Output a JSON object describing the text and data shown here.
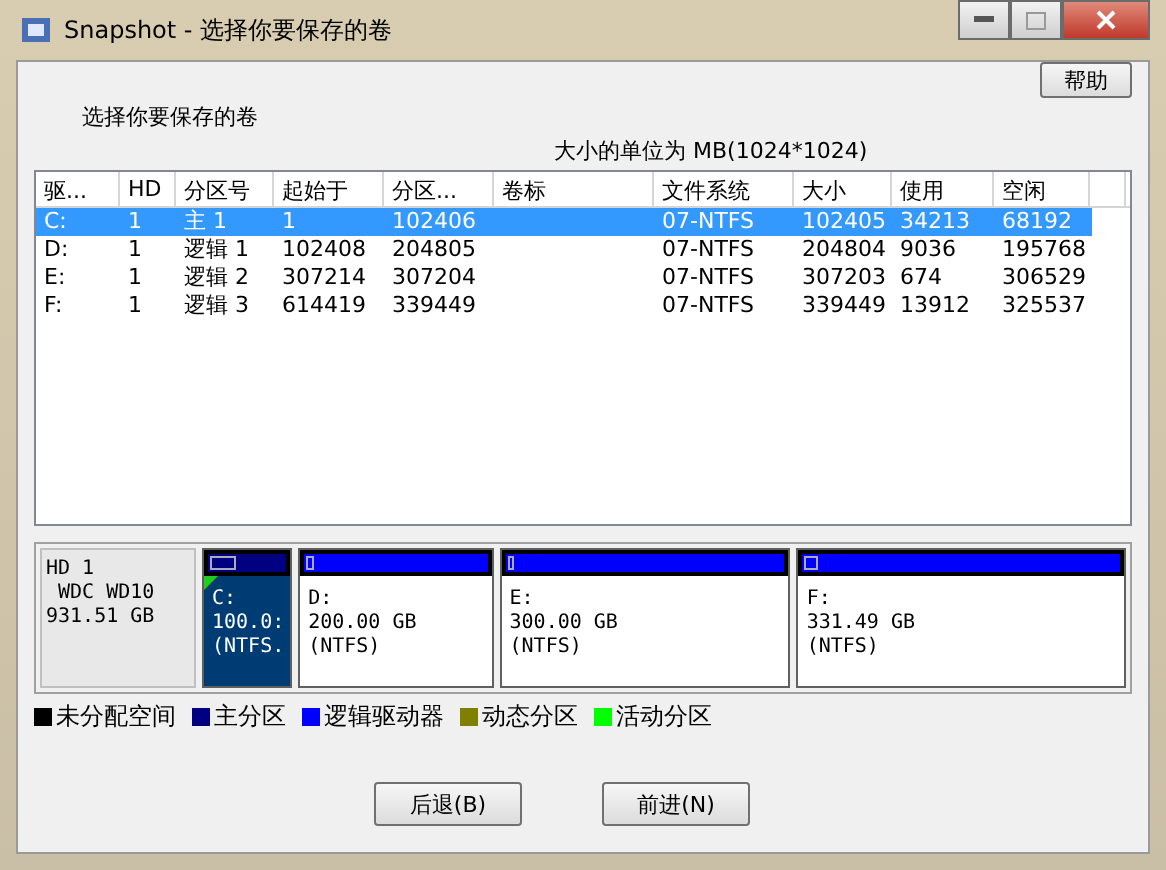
{
  "window": {
    "title": "Snapshot - 选择你要保存的卷"
  },
  "help_button": "帮助",
  "prompt": "选择你要保存的卷",
  "unit_note": "大小的单位为 MB(1024*1024)",
  "table": {
    "columns": [
      "驱...",
      "HD",
      "分区号",
      "起始于",
      "分区...",
      "卷标",
      "文件系统",
      "大小",
      "使用",
      "空闲"
    ],
    "rows": [
      {
        "selected": true,
        "cells": [
          "C:",
          "1",
          "主  1",
          "1",
          "102406",
          "",
          "07-NTFS",
          "102405",
          "34213",
          "68192"
        ]
      },
      {
        "selected": false,
        "cells": [
          "D:",
          "1",
          "逻辑 1",
          "102408",
          "204805",
          "",
          "07-NTFS",
          "204804",
          "9036",
          "195768"
        ]
      },
      {
        "selected": false,
        "cells": [
          "E:",
          "1",
          "逻辑 2",
          "307214",
          "307204",
          "",
          "07-NTFS",
          "307203",
          "674",
          "306529"
        ]
      },
      {
        "selected": false,
        "cells": [
          "F:",
          "1",
          "逻辑 3",
          "614419",
          "339449",
          "",
          "07-NTFS",
          "339449",
          "13912",
          "325537"
        ]
      }
    ]
  },
  "disk": {
    "lines": [
      "HD 1",
      " WDC WD10",
      "931.51 GB"
    ],
    "partitions": [
      {
        "kind": "primary",
        "selected": true,
        "active": true,
        "level": 0.33,
        "lines": [
          "C:",
          "100.0:",
          "(NTFS."
        ]
      },
      {
        "kind": "logical",
        "selected": false,
        "active": false,
        "level": 0.04,
        "lines": [
          "D:",
          "200.00 GB",
          "(NTFS)"
        ]
      },
      {
        "kind": "logical",
        "selected": false,
        "active": false,
        "level": 0.02,
        "lines": [
          "E:",
          "300.00 GB",
          "(NTFS)"
        ]
      },
      {
        "kind": "logical",
        "selected": false,
        "active": false,
        "level": 0.04,
        "lines": [
          "F:",
          "331.49 GB",
          "(NTFS)"
        ]
      }
    ]
  },
  "legend": [
    {
      "label": "未分配空间",
      "color": "#000000"
    },
    {
      "label": "主分区",
      "color": "#000080"
    },
    {
      "label": "逻辑驱动器",
      "color": "#0000ff"
    },
    {
      "label": "动态分区",
      "color": "#808000"
    },
    {
      "label": "活动分区",
      "color": "#00ff00"
    }
  ],
  "buttons": [
    "后退(B)",
    "前进(N)"
  ]
}
